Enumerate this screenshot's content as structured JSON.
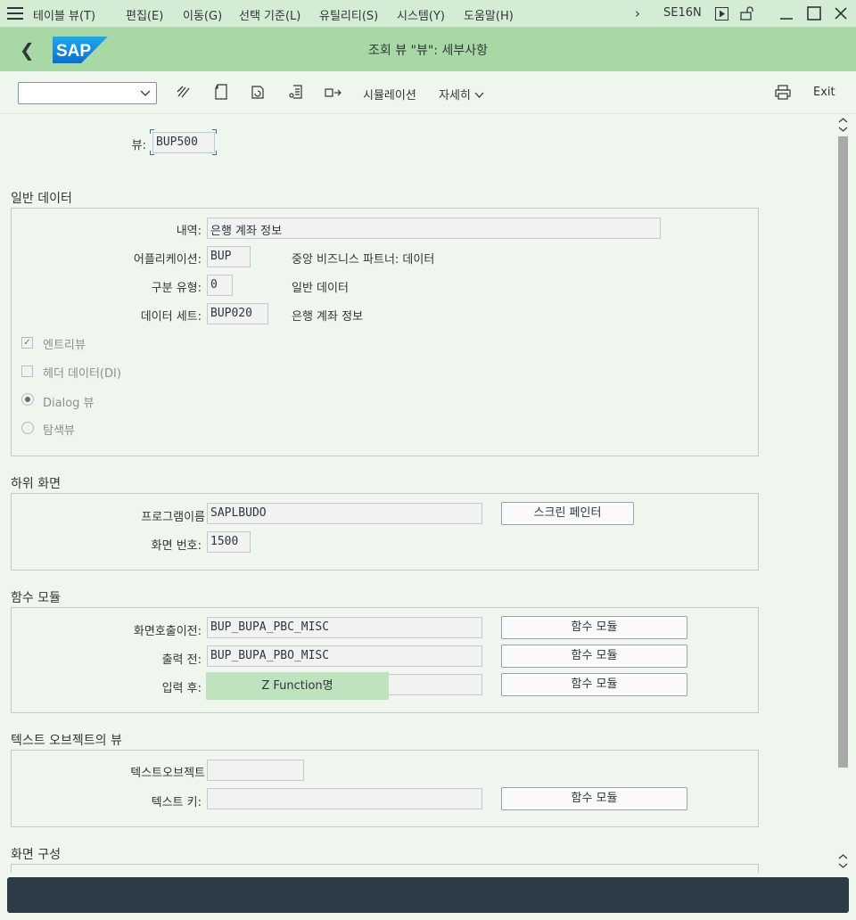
{
  "menubar": {
    "items": [
      "테이블 뷰(T)",
      "편집(E)",
      "이동(G)",
      "선택 기준(L)",
      "유틸리티(S)",
      "시스템(Y)",
      "도움말(H)"
    ],
    "tcode": "SE16N"
  },
  "titlebar": {
    "title": "조회 뷰 \"뷰\": 세부사항",
    "logo_text": "SAP"
  },
  "toolbar": {
    "simulation": "시뮬레이션",
    "details": "자세히",
    "exit": "Exit"
  },
  "view": {
    "label": "뷰:",
    "value": "BUP500"
  },
  "general": {
    "title": "일반 데이터",
    "description_label": "내역:",
    "description_value": "은행 계좌 정보",
    "application_label": "어플리케이션:",
    "application_value": "BUP",
    "application_desc": "중앙 비즈니스 파트너: 데이터",
    "type_label": "구분 유형:",
    "type_value": "0",
    "type_desc": "일반 데이터",
    "dataset_label": "데이터 세트:",
    "dataset_value": "BUP020",
    "dataset_desc": "은행 계좌 정보",
    "entry_view": "엔트리뷰",
    "header_data": "헤더 데이터(DI)",
    "dialog_view": "Dialog 뷰",
    "search_view": "탐색뷰"
  },
  "subscreen": {
    "title": "하위 화면",
    "program_label": "프로그램이름",
    "program_value": "SAPLBUDO",
    "screen_painter": "스크린 페인터",
    "screen_no_label": "화면 번호:",
    "screen_no_value": "1500"
  },
  "function_modules": {
    "title": "함수 모듈",
    "before_call_label": "화면호출이전:",
    "before_call_value": "BUP_BUPA_PBC_MISC",
    "before_output_label": "출력 전:",
    "before_output_value": "BUP_BUPA_PBO_MISC",
    "after_input_label": "입력 후:",
    "after_input_value": "",
    "button": "함수 모듈",
    "overlay": "Z Function명"
  },
  "text_object": {
    "title": "텍스트 오브젝트의 뷰",
    "object_label": "텍스트오브젝트",
    "object_value": "",
    "key_label": "텍스트 키:",
    "key_value": "",
    "button": "함수 모듈"
  },
  "screen_config": {
    "title": "화면 구성"
  }
}
